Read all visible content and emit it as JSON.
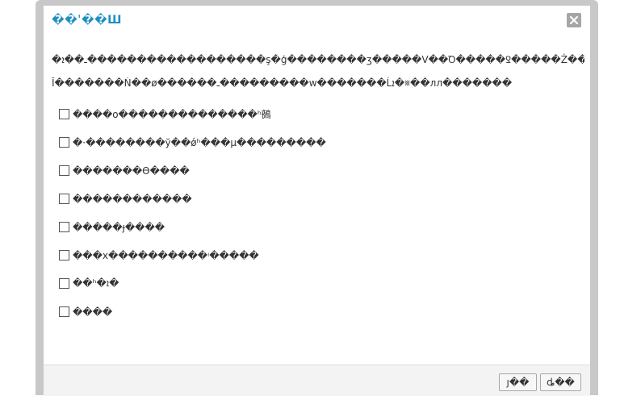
{
  "dialog": {
    "title": "��ˈ��Ш",
    "close_icon": "close-icon",
    "description_line1": "�ـ��ܐ������������������ş�ģ��������ʒ�����V��Ꝺ�����Ꝿ�����Ż���������ʾ�ǻ�",
    "description_line2": "Ĭ�������Ṅ��ø������ـ���������w�������Ĺܐ�␧��лл�������",
    "options": [
      {
        "label": "����o��������������ʰ鵺",
        "checked": false
      },
      {
        "label": "�·��������ў��ǿʰ���µ���������",
        "checked": false
      },
      {
        "label": "�������ϴ����",
        "checked": false
      },
      {
        "label": "������������",
        "checked": false
      },
      {
        "label": "�����ɟ����",
        "checked": false
      },
      {
        "label": "���x����������ᵎ�����",
        "checked": false
      },
      {
        "label": "��ʰ�ܐ�",
        "checked": false
      },
      {
        "label": "����",
        "checked": false
      }
    ]
  },
  "footer": {
    "ok_label": "ȷ��",
    "cancel_label": "ȡ��"
  }
}
